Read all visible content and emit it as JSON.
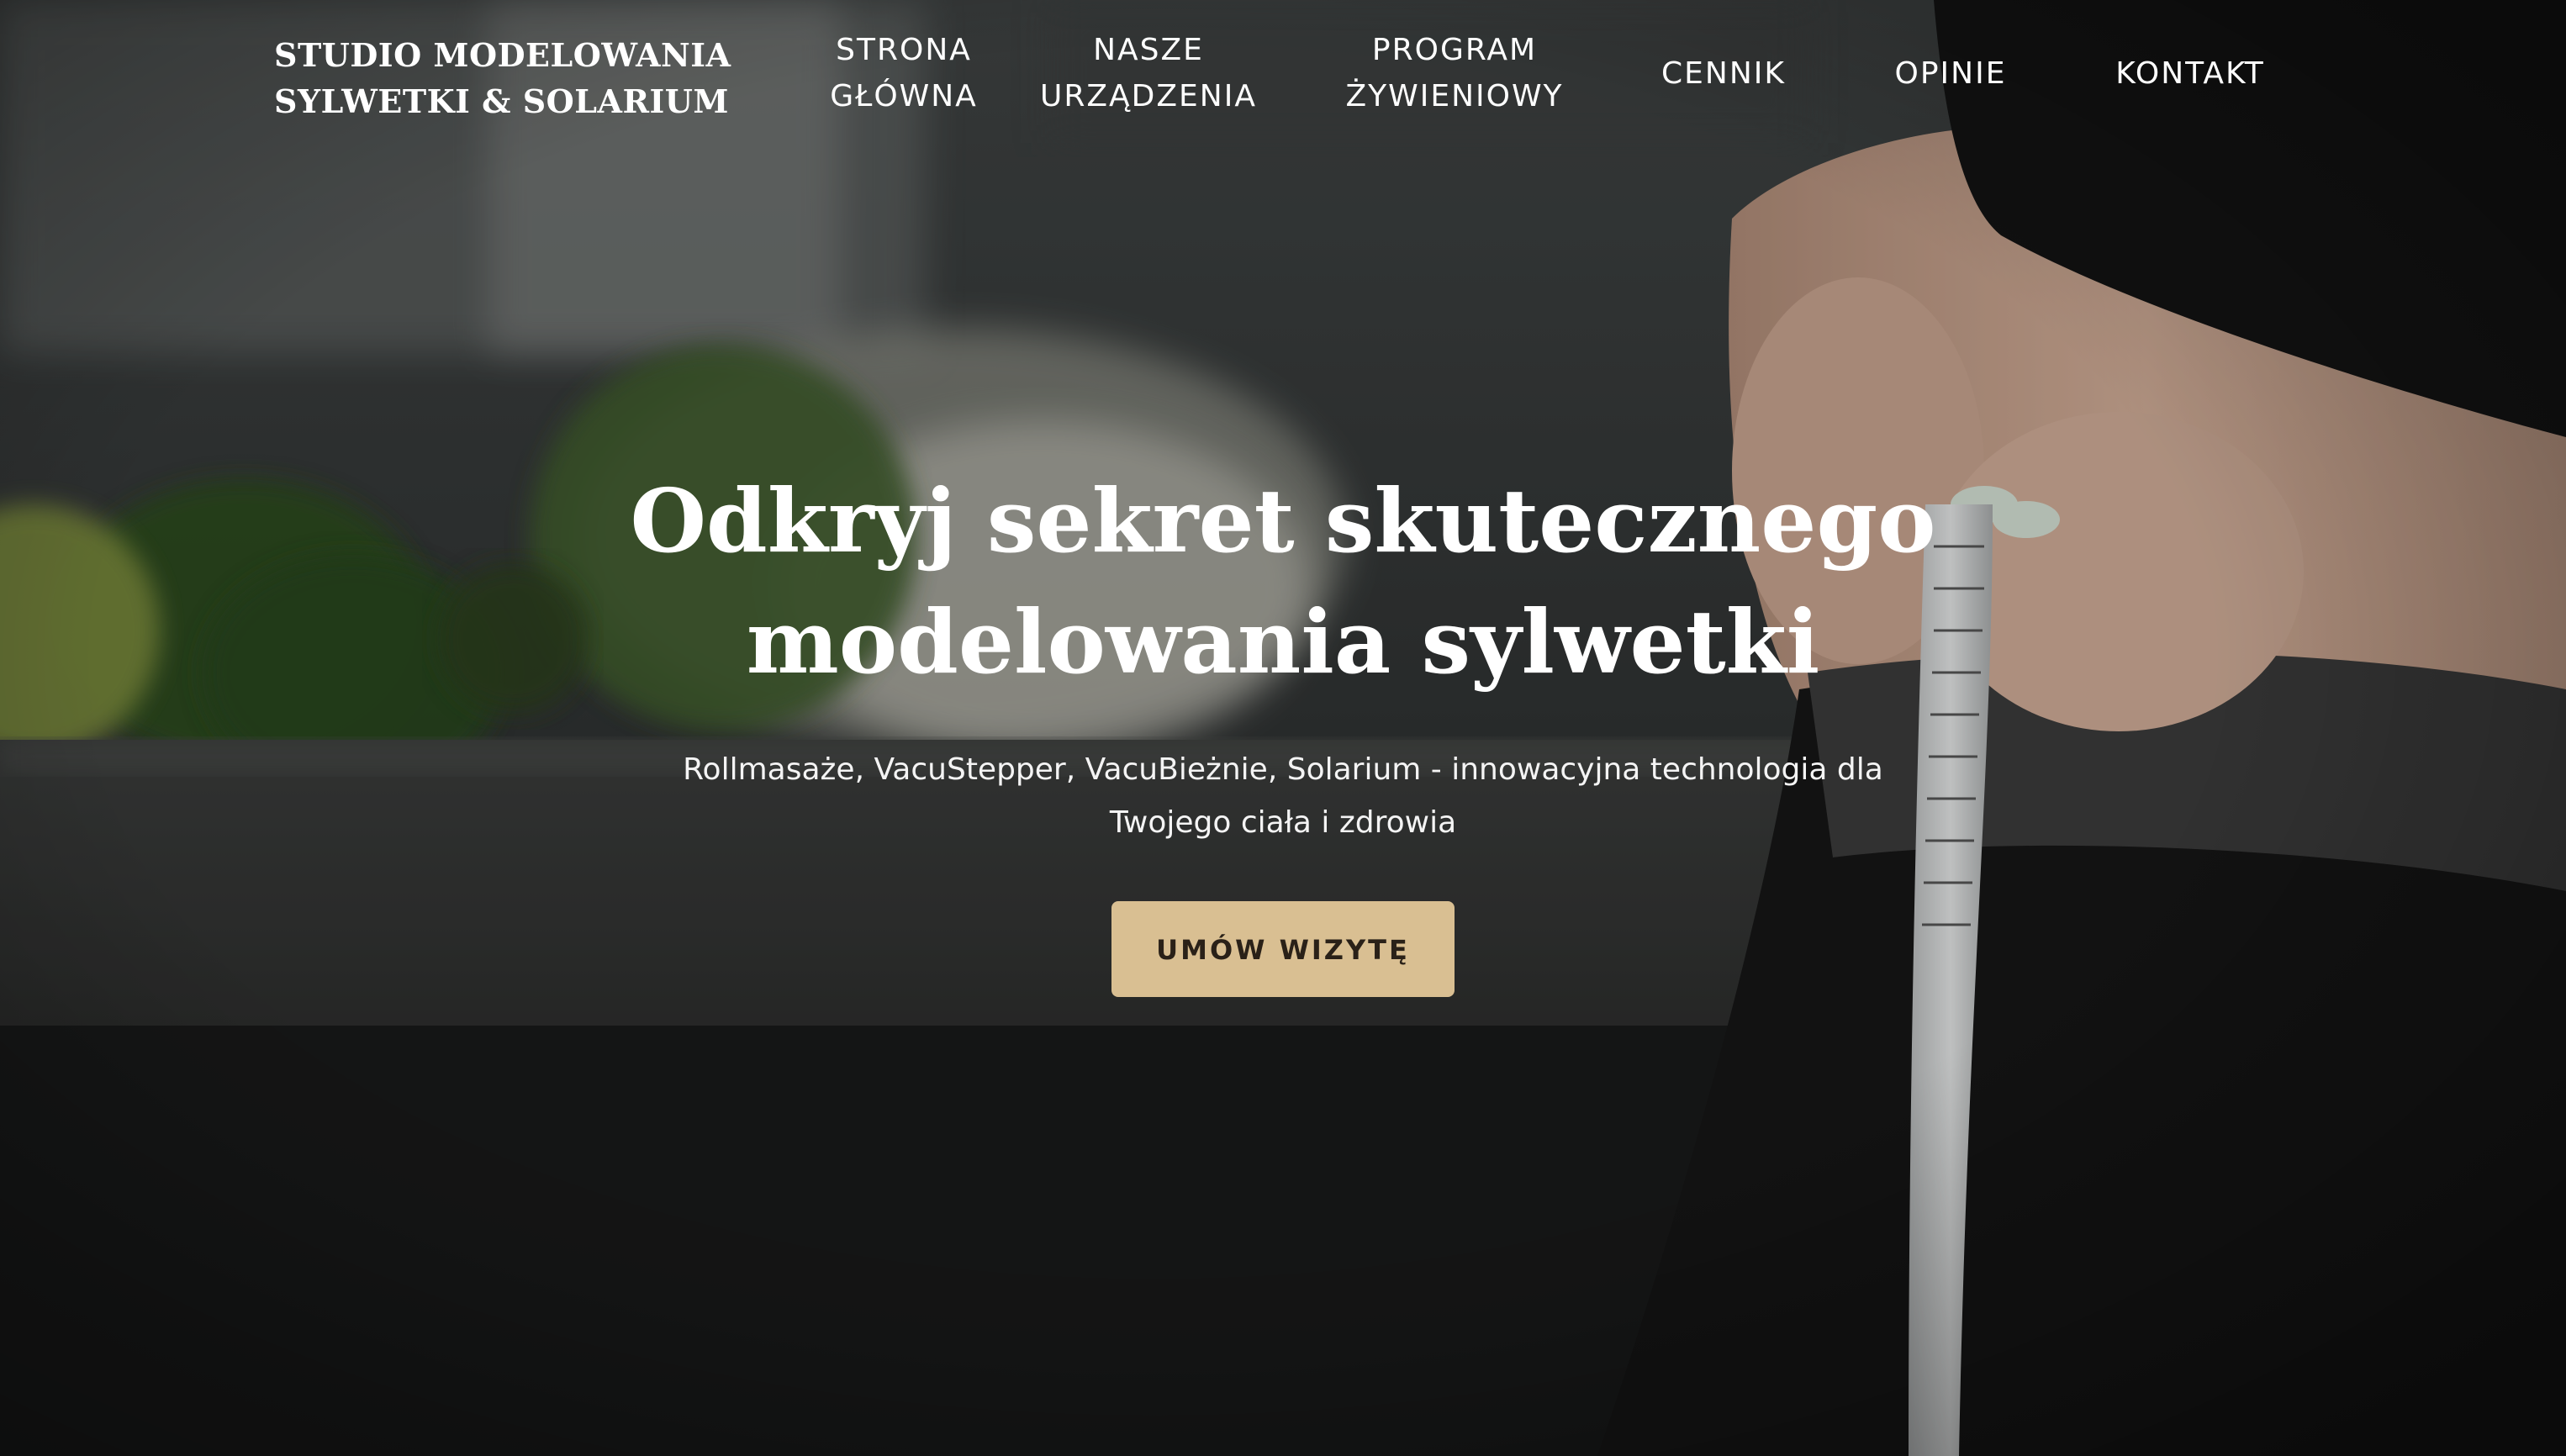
{
  "brand": {
    "line1": "STUDIO MODELOWANIA",
    "line2": "SYLWETKI & SOLARIUM"
  },
  "nav": {
    "items": [
      {
        "line1": "STRONA",
        "line2": "GŁÓWNA"
      },
      {
        "line1": "NASZE",
        "line2": "URZĄDZENIA"
      },
      {
        "line1": "PROGRAM",
        "line2": "ŻYWIENIOWY"
      },
      {
        "line1": "CENNIK"
      },
      {
        "line1": "OPINIE"
      },
      {
        "line1": "KONTAKT"
      }
    ]
  },
  "hero": {
    "headline_line1": "Odkryj sekret skutecznego",
    "headline_line2": "modelowania sylwetki",
    "subtitle_line1": "Rollmasaże, VacuStepper, VacuBieżnie, Solarium - innowacyjna technologia dla",
    "subtitle_line2": "Twojego ciała i zdrowia",
    "cta_label": "UMÓW WIZYTĘ"
  },
  "colors": {
    "accent": "#d9bf92",
    "text": "#ffffff",
    "cta_text": "#2a2118"
  }
}
